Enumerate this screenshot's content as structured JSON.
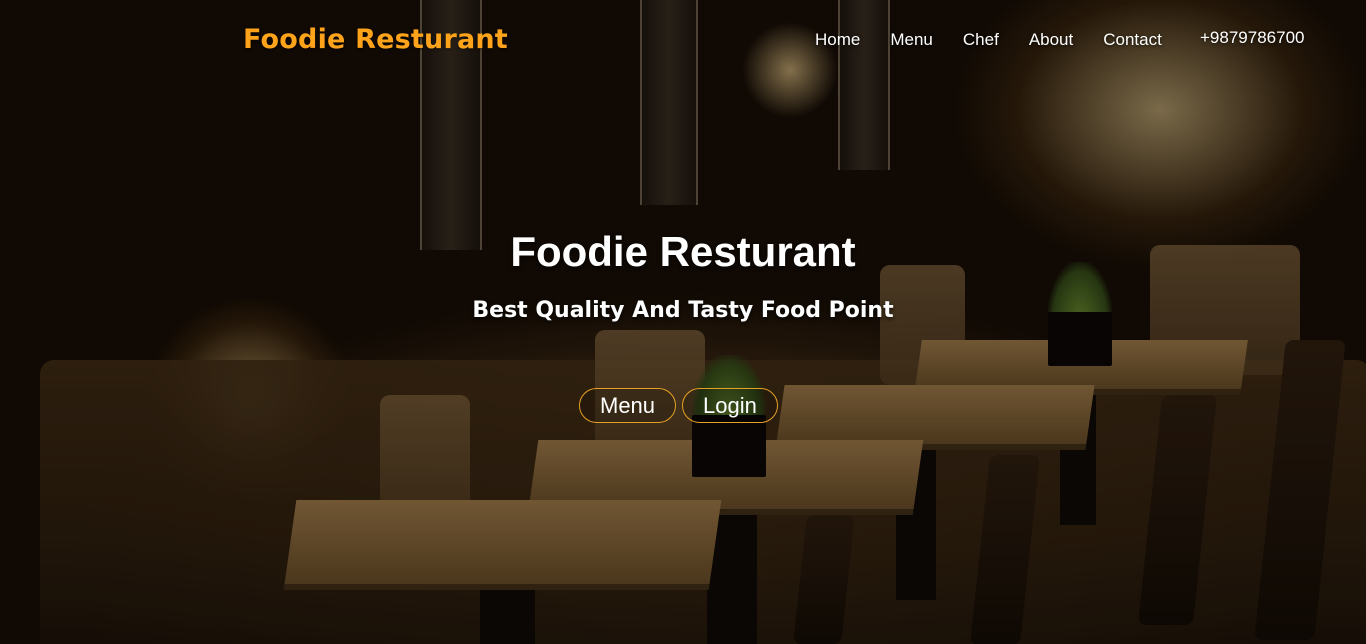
{
  "brand": {
    "name": "Foodie Resturant",
    "color": "#ffa31a"
  },
  "nav": {
    "items": [
      {
        "label": "Home"
      },
      {
        "label": "Menu"
      },
      {
        "label": "Chef"
      },
      {
        "label": "About"
      },
      {
        "label": "Contact"
      }
    ],
    "phone": "+9879786700"
  },
  "hero": {
    "title": "Foodie Resturant",
    "subtitle": "Best Quality And Tasty Food Point",
    "buttons": [
      {
        "label": "Menu"
      },
      {
        "label": "Login"
      }
    ],
    "button_border_color": "#e6a023"
  }
}
